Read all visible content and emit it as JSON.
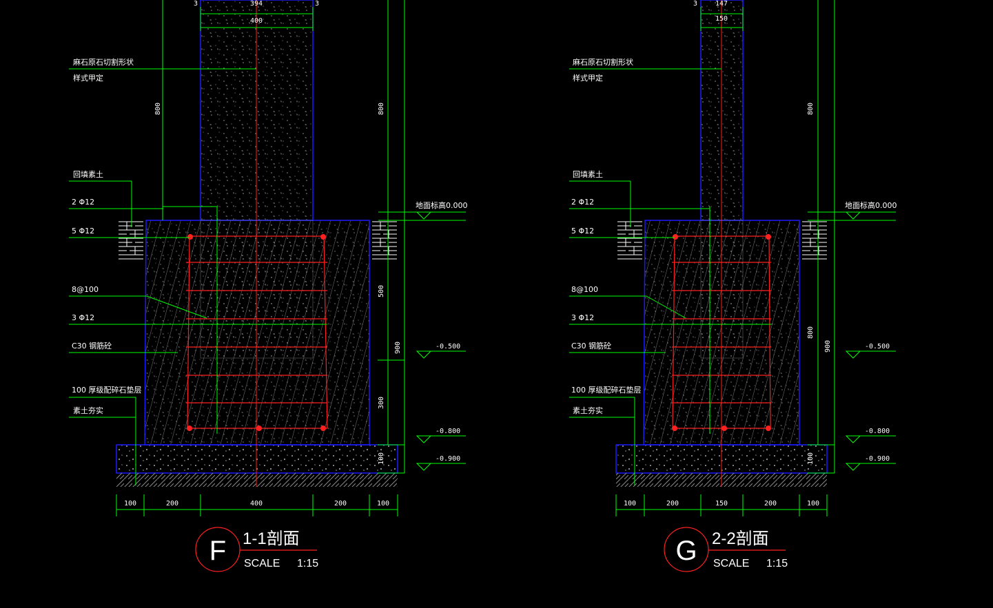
{
  "colors": {
    "background": "#000000",
    "dimension": "#00ff00",
    "outline": "#1a1aff",
    "rebar": "#ff2020",
    "text": "#ffffff",
    "hatch": "#7a7a7a"
  },
  "sections": [
    {
      "badge": "F",
      "title": "1-1剖面",
      "scale_label": "SCALE",
      "scale_value": "1:15",
      "top_dims": {
        "left": "3",
        "mid": "394",
        "right": "3",
        "total": "400"
      },
      "labels": {
        "stone": "麻石原石切割形状",
        "style": "样式甲定",
        "backfill": "回填素土",
        "bar_a": "2 Φ12",
        "bar_b": "5 Φ12",
        "stirrup": "8@100",
        "bar_c": "3 Φ12",
        "concrete": "C30  钢筋砼",
        "gravel": "100  厚级配碎石垫层",
        "soil": "素土夯实"
      },
      "vertical_dims": {
        "inner_top": "800",
        "outer_top": "800",
        "d500": "500",
        "d900": "900",
        "d300": "300",
        "d100": "100"
      },
      "elevations": {
        "ground": "地面标高0.000",
        "e500": "-0.500",
        "e800": "-0.800",
        "e900": "-0.900"
      },
      "bottom_dims": [
        "100",
        "200",
        "400",
        "200",
        "100"
      ]
    },
    {
      "badge": "G",
      "title": "2-2剖面",
      "scale_label": "SCALE",
      "scale_value": "1:15",
      "top_dims": {
        "left": "3",
        "mid": "147",
        "right": "",
        "total": "150"
      },
      "labels": {
        "stone": "麻石原石切割形状",
        "style": "样式甲定",
        "backfill": "回填素土",
        "bar_a": "2 Φ12",
        "bar_b": "5 Φ12",
        "stirrup": "8@100",
        "bar_c": "3 Φ12",
        "concrete": "C30  钢筋砼",
        "gravel": "100  厚级配碎石垫层",
        "soil": "素土夯实"
      },
      "vertical_dims": {
        "inner_top": "800",
        "outer_top": "",
        "d800": "800",
        "d900": "900",
        "d100": "100"
      },
      "elevations": {
        "ground": "地面标高0.000",
        "e500": "-0.500",
        "e800": "-0.800",
        "e900": "-0.900"
      },
      "bottom_dims": [
        "100",
        "200",
        "150",
        "200",
        "100"
      ]
    }
  ]
}
